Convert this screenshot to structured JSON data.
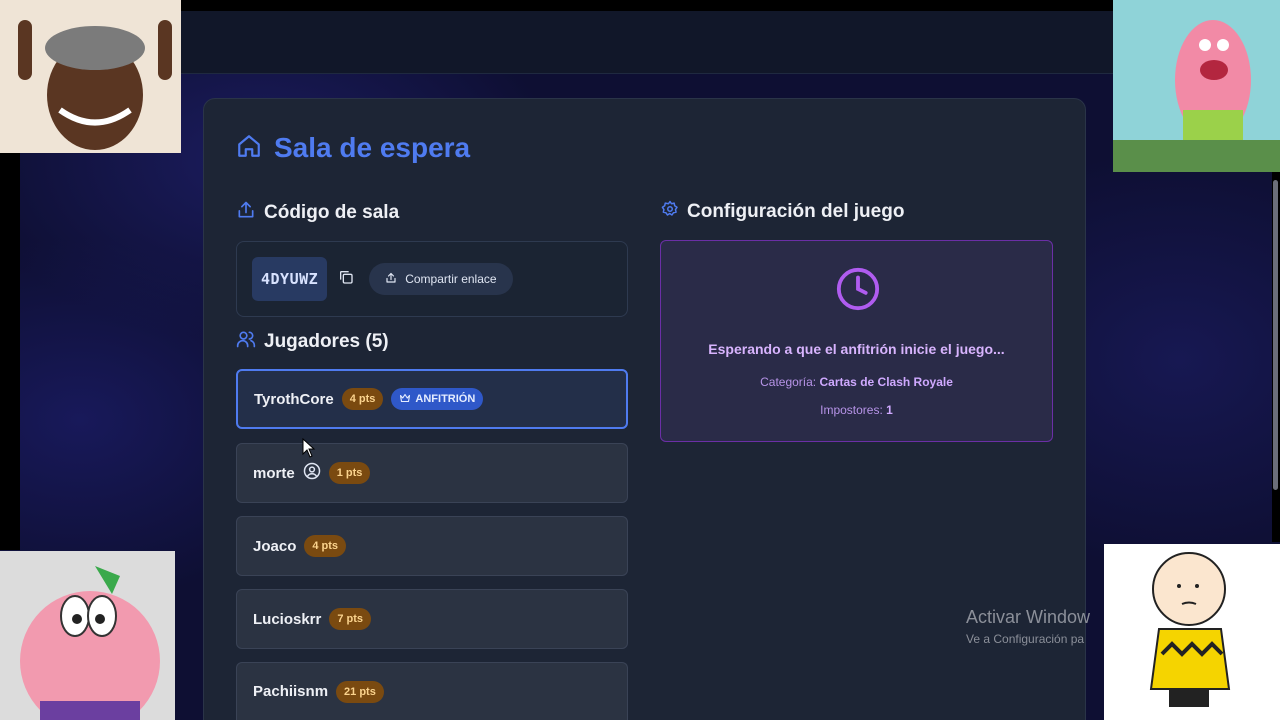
{
  "lobby": {
    "title": "Sala de espera",
    "room_code_heading": "Código de sala",
    "room_code": "4DYUWZ",
    "share_label": "Compartir enlace",
    "players_heading": "Jugadores (5)",
    "players": [
      {
        "name": "TyrothCore",
        "points": "4 pts",
        "badge": "ANFITRIÓN"
      },
      {
        "name": "morte",
        "points": "1 pts"
      },
      {
        "name": "Joaco",
        "points": "4 pts"
      },
      {
        "name": "Lucioskrr",
        "points": "7 pts"
      },
      {
        "name": "Pachiisnm",
        "points": "21 pts"
      }
    ]
  },
  "config": {
    "heading": "Configuración del juego",
    "waiting_text": "Esperando a que el anfitrión inicie el juego...",
    "category_label": "Categoría:",
    "category_value": "Cartas de Clash Royale",
    "impostors_label": "Impostores:",
    "impostors_value": "1"
  },
  "watermark": {
    "line1": "Activar Window",
    "line2": "Ve a Configuración pa"
  },
  "icons": {
    "title": "home-icon",
    "room_code": "upload-icon",
    "copy": "copy-icon",
    "share": "share-icon",
    "players": "users-icon",
    "host": "crown-icon",
    "user": "user-circle-icon",
    "config": "gear-icon",
    "clock": "clock-icon"
  },
  "colors": {
    "accent_blue": "#4f7bf0",
    "points_badge": "#7a4a10",
    "config_border": "#6b2fa6",
    "waiting_text": "#d8b4fe"
  }
}
